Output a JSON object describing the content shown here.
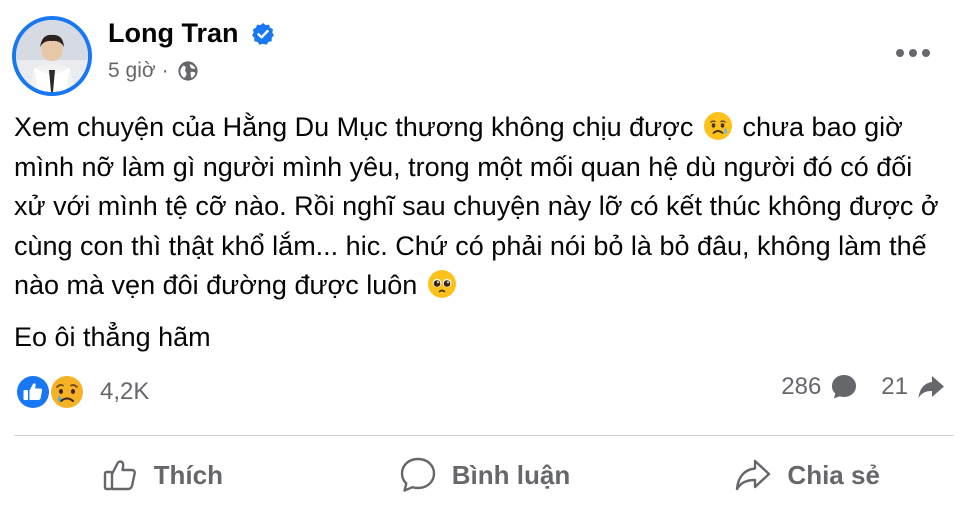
{
  "author": {
    "name": "Long Tran",
    "verified": true,
    "time": "5 giờ",
    "audience_icon": "globe-icon"
  },
  "post": {
    "paragraph1_part1": "Xem chuyện của Hằng Du Mục thương không chịu được",
    "paragraph1_part2": "chưa bao giờ mình nỡ làm gì người mình yêu, trong một mối quan hệ dù người đó có đối xử với mình tệ cỡ nào. Rồi nghĩ sau chuyện này lỡ có kết thúc không được ở cùng con thì thật khổ lắm... hic. Chứ có phải nói bỏ là bỏ đâu, không làm thế nào mà vẹn đôi đường được luôn",
    "paragraph2": "Eo ôi thẳng hãm",
    "emoji1": "sad-but-relieved-emoji",
    "emoji2": "pleading-face-emoji"
  },
  "reactions": {
    "types": [
      "like-reaction-icon",
      "sad-reaction-icon"
    ],
    "count": "4,2K",
    "comments": "286",
    "shares": "21"
  },
  "actions": {
    "like": "Thích",
    "comment": "Bình luận",
    "share": "Chia sẻ"
  },
  "colors": {
    "accent": "#1877f2",
    "secondary_text": "#65676b",
    "divider": "#ced0d4",
    "sad_yellow": "#f7b125"
  }
}
